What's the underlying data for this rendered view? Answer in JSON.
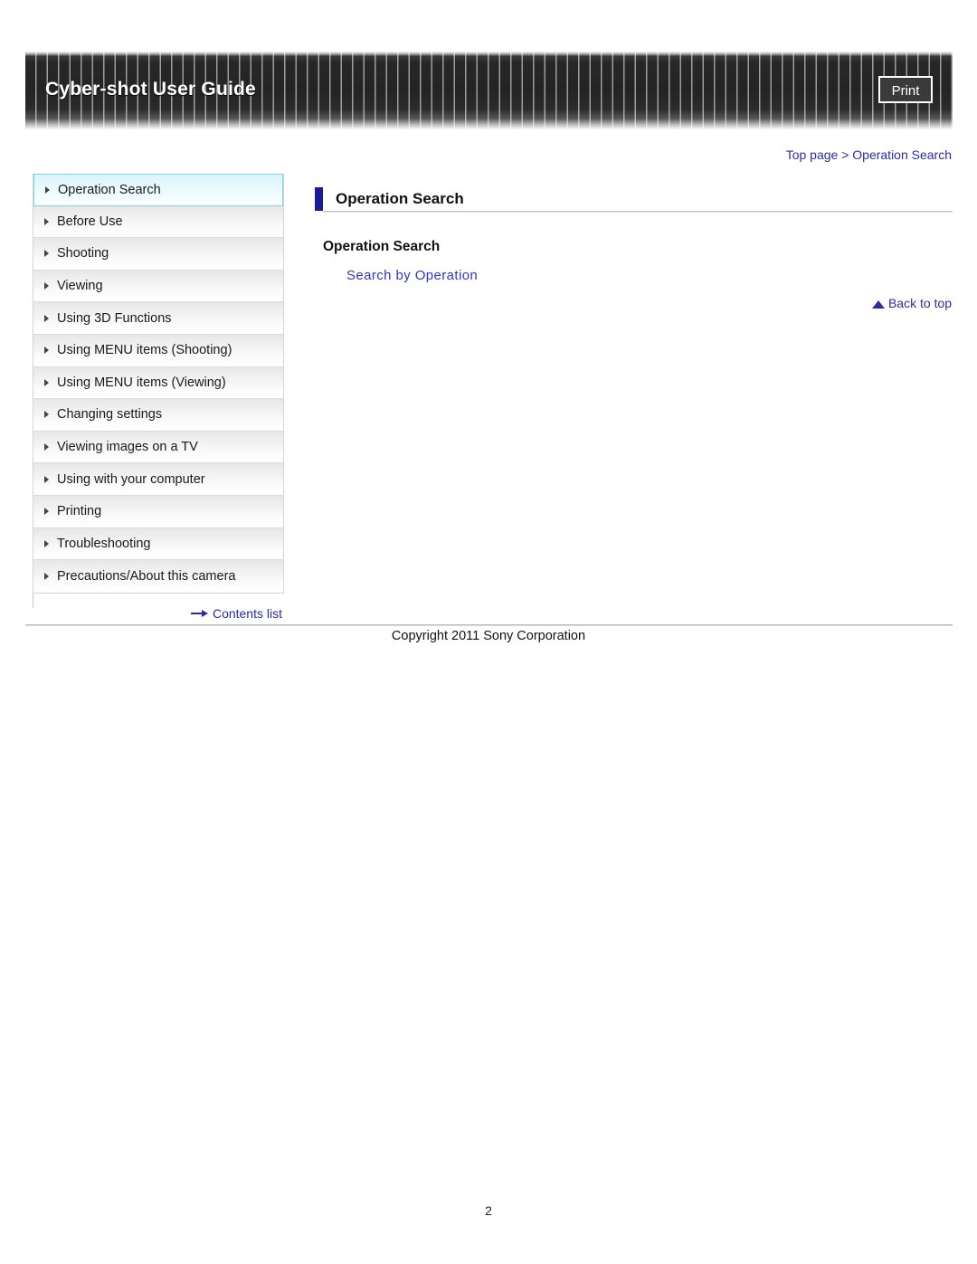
{
  "header": {
    "title": "Cyber-shot User Guide",
    "print_label": "Print"
  },
  "breadcrumb": {
    "text": "Top page > Operation Search"
  },
  "sidebar": {
    "items": [
      {
        "label": "Operation Search",
        "active": true
      },
      {
        "label": "Before Use",
        "active": false
      },
      {
        "label": "Shooting",
        "active": false
      },
      {
        "label": "Viewing",
        "active": false
      },
      {
        "label": "Using 3D Functions",
        "active": false
      },
      {
        "label": "Using MENU items (Shooting)",
        "active": false
      },
      {
        "label": "Using MENU items (Viewing)",
        "active": false
      },
      {
        "label": "Changing settings",
        "active": false
      },
      {
        "label": "Viewing images on a TV",
        "active": false
      },
      {
        "label": "Using with your computer",
        "active": false
      },
      {
        "label": "Printing",
        "active": false
      },
      {
        "label": "Troubleshooting",
        "active": false
      },
      {
        "label": "Precautions/About this camera",
        "active": false
      }
    ],
    "contents_list_label": "Contents list"
  },
  "main": {
    "section_title": "Operation Search",
    "sub_heading": "Operation Search",
    "link_label": "Search by Operation",
    "back_to_top_label": "Back to top"
  },
  "footer": {
    "copyright": "Copyright 2011 Sony Corporation",
    "page_number": "2"
  },
  "colors": {
    "link": "#2b2ba8",
    "content_link": "#3333cc",
    "accent_bar": "#1a1a9c",
    "active_item": "#d9f4fb",
    "active_item_border": "#7fd3ef",
    "banner_dark": "#242424"
  }
}
